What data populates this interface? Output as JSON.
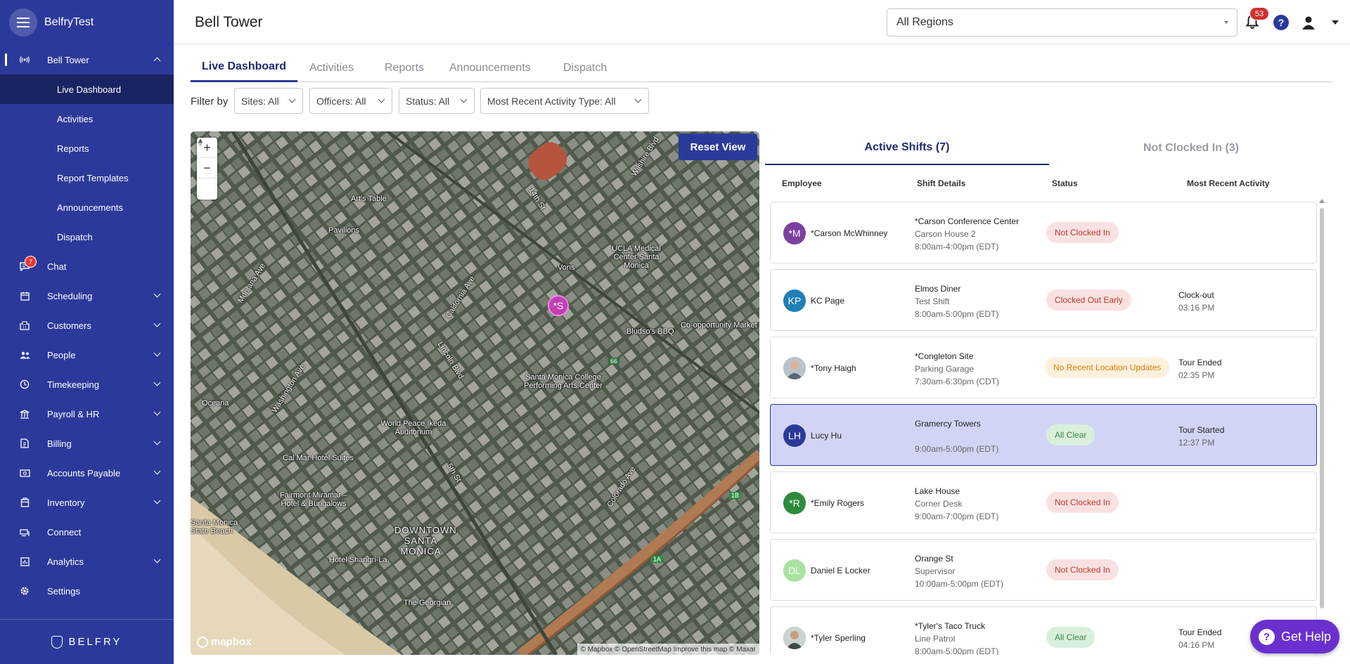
{
  "app": {
    "brand": "BelfryTest",
    "footer_logo": "BELFRY"
  },
  "sidebar": {
    "section": {
      "label": "Bell Tower",
      "icon": "broadcast-icon"
    },
    "sub_items": [
      "Live Dashboard",
      "Activities",
      "Reports",
      "Report Templates",
      "Announcements",
      "Dispatch"
    ],
    "active_sub": "Live Dashboard",
    "items": [
      {
        "label": "Chat",
        "icon": "chat-icon",
        "badge": "7"
      },
      {
        "label": "Scheduling",
        "icon": "calendar-icon"
      },
      {
        "label": "Customers",
        "icon": "building-icon"
      },
      {
        "label": "People",
        "icon": "people-icon"
      },
      {
        "label": "Timekeeping",
        "icon": "clock-icon"
      },
      {
        "label": "Payroll & HR",
        "icon": "bank-icon"
      },
      {
        "label": "Billing",
        "icon": "invoice-icon"
      },
      {
        "label": "Accounts Payable",
        "icon": "money-icon"
      },
      {
        "label": "Inventory",
        "icon": "box-icon"
      },
      {
        "label": "Connect",
        "icon": "connect-icon"
      },
      {
        "label": "Analytics",
        "icon": "analytics-icon"
      },
      {
        "label": "Settings",
        "icon": "gear-icon"
      }
    ]
  },
  "header": {
    "title": "Bell Tower",
    "region_select": "All Regions",
    "notification_count": "53",
    "help_glyph": "?"
  },
  "tabs": [
    "Live Dashboard",
    "Activities",
    "Reports",
    "Announcements",
    "Dispatch"
  ],
  "filters": {
    "label": "Filter by",
    "items": [
      "Sites: All",
      "Officers: All",
      "Status: All",
      "Most Recent Activity Type: All"
    ]
  },
  "map": {
    "reset_label": "Reset View",
    "zoom_in": "+",
    "zoom_out": "−",
    "logo": "mapbox",
    "attribution": "© Mapbox © OpenStreetMap Improve this map © Maxar",
    "marker_label": "*S",
    "labels": [
      "Art's Table",
      "Pavilions",
      "UCLA Medical Center Santa Monica",
      "Vons",
      "Bludso's BBQ",
      "Co-opportunity Market",
      "Santa Monica College Performing Arts Center",
      "World Peace Ikeda Auditorium",
      "Cal Mar Hotel Suites",
      "Fairmont Miramar – Hotel & Bungalows",
      "Santa Monica State Beach",
      "DOWNTOWN SANTA MONICA",
      "Hotel Shangri-La",
      "The Georgian",
      "Oceana",
      "Montana Ave",
      "Wilshire Blvd",
      "Lincoln Blvd",
      "California Ave",
      "Washington Ave",
      "Colorado Ave",
      "14th St",
      "5th St",
      "66",
      "1A",
      "1B"
    ]
  },
  "panel": {
    "tab_active": "Active Shifts (7)",
    "tab_inactive": "Not Clocked In (3)",
    "columns": [
      "Employee",
      "Shift Details",
      "Status",
      "Most Recent Activity"
    ],
    "rows": [
      {
        "initials": "*M",
        "avatar_color": "#7b3fa0",
        "name": "*Carson McWhinney",
        "site": "*Carson Conference Center",
        "post": "Carson House 2",
        "time": "8:00am-4:00pm (EDT)",
        "status": "Not Clocked In",
        "status_kind": "red",
        "activity": "",
        "activity_time": ""
      },
      {
        "initials": "KP",
        "avatar_color": "#1f7fb8",
        "name": "KC Page",
        "site": "Elmos Diner",
        "post": "Test Shift",
        "time": "8:00am-5:00pm (EDT)",
        "status": "Clocked Out Early",
        "status_kind": "red",
        "activity": "Clock-out",
        "activity_time": "03:16 PM"
      },
      {
        "initials": "",
        "avatar_color": "#9aa4ad",
        "name": "*Tony Haigh",
        "site": "*Congleton Site",
        "post": "Parking Garage",
        "time": "7:30am-6:30pm (CDT)",
        "status": "No Recent Location Updates",
        "status_kind": "orange",
        "activity": "Tour Ended",
        "activity_time": "02:35 PM"
      },
      {
        "initials": "LH",
        "avatar_color": "#2b3a9a",
        "name": "Lucy Hu",
        "site": "Gramercy Towers",
        "post": "",
        "time": "9:00am-5:00pm (EDT)",
        "status": "All Clear",
        "status_kind": "green",
        "activity": "Tour Started",
        "activity_time": "12:37 PM"
      },
      {
        "initials": "*R",
        "avatar_color": "#2e8b3e",
        "name": "*Emily Rogers",
        "site": "Lake House",
        "post": "Corner Desk",
        "time": "9:00am-7:00pm (EDT)",
        "status": "Not Clocked In",
        "status_kind": "red",
        "activity": "",
        "activity_time": ""
      },
      {
        "initials": "DL",
        "avatar_color": "#a9e2a0",
        "name": "Daniel E Locker",
        "site": "Orange St",
        "post": "Supervisor",
        "time": "10:00am-5:00pm (EDT)",
        "status": "Not Clocked In",
        "status_kind": "red",
        "activity": "",
        "activity_time": ""
      },
      {
        "initials": "",
        "avatar_color": "#8a6a58",
        "name": "*Tyler Sperling",
        "site": "*Tyler's Taco Truck",
        "post": "Line Patrol",
        "time": "8:00am-5:00pm (EDT)",
        "status": "All Clear",
        "status_kind": "green",
        "activity": "Tour Ended",
        "activity_time": "04:16 PM"
      }
    ]
  },
  "get_help": "Get Help"
}
